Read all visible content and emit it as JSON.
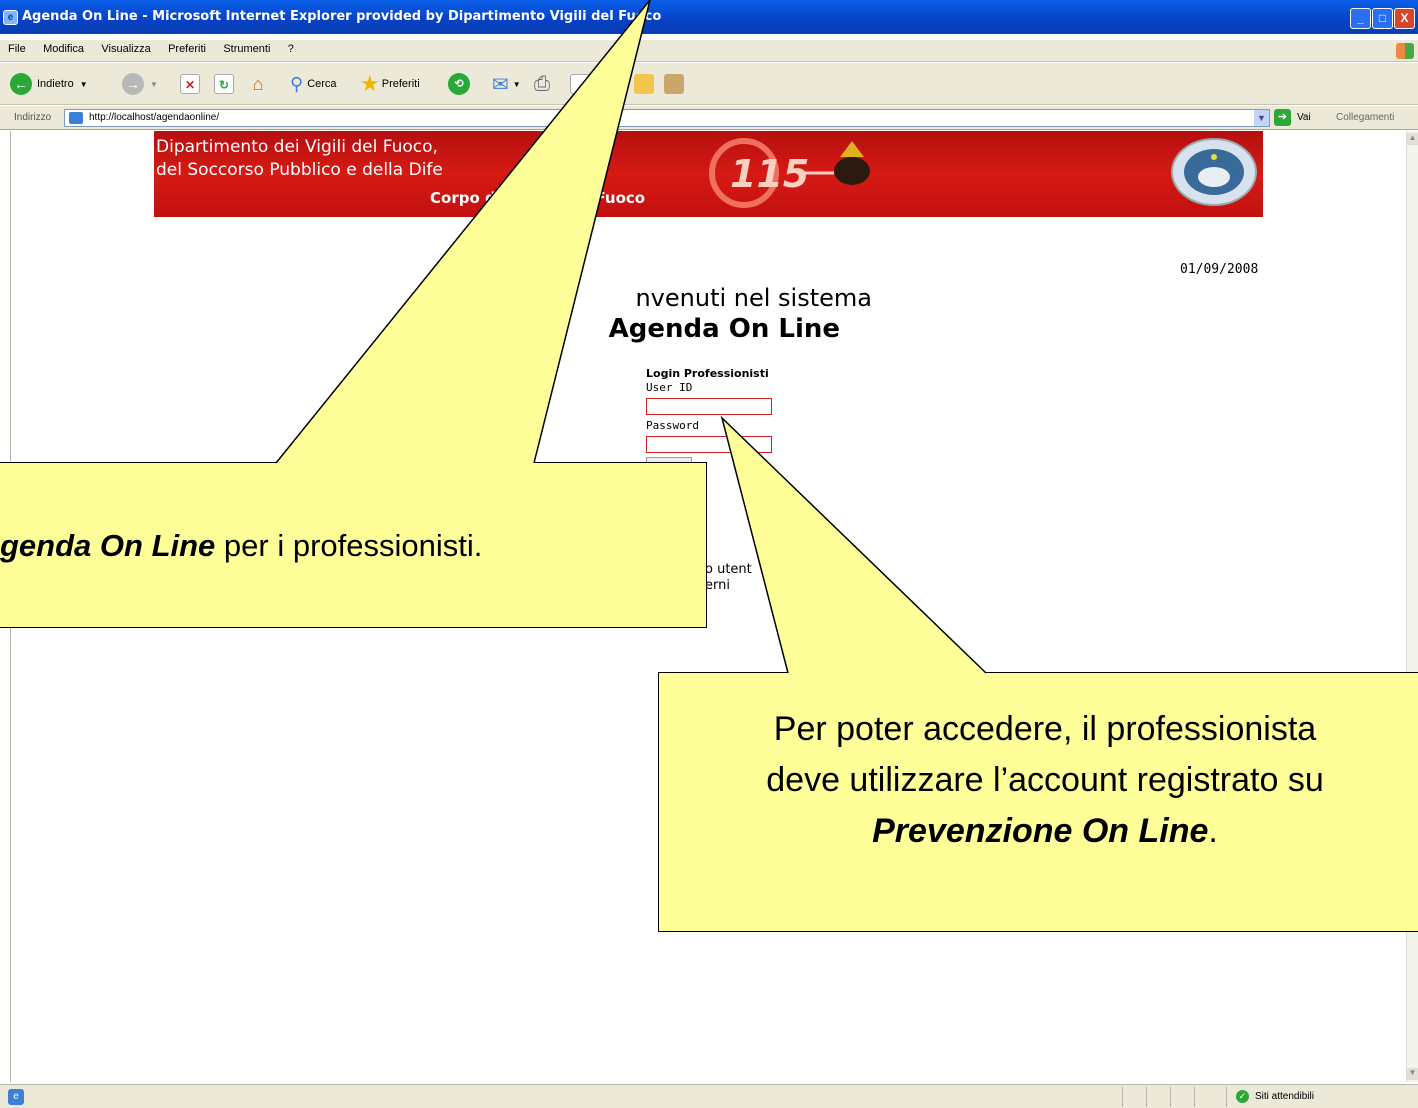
{
  "window": {
    "title": "Agenda On Line - Microsoft Internet Explorer provided by Dipartimento Vigili del Fuoco",
    "minimize": "_",
    "maximize": "□",
    "close": "X"
  },
  "menu": [
    "File",
    "Modifica",
    "Visualizza",
    "Preferiti",
    "Strumenti",
    "?"
  ],
  "toolbar": {
    "back": "Indietro",
    "search": "Cerca",
    "favorites": "Preferiti"
  },
  "addressbar": {
    "label": "Indirizzo",
    "url": "http://localhost/agendaonline/",
    "go": "Vai",
    "links": "Collegamenti"
  },
  "banner": {
    "line1": "Dipartimento dei Vigili del Fuoco,",
    "line2": "del Soccorso Pubblico e della Dife",
    "line3": "Corpo          dei Vigili del Fuoco",
    "emblem_number": "115"
  },
  "page": {
    "date": "01/09/2008",
    "welcome": "nvenuti nel sistema",
    "system_name": "Agenda On Line",
    "login_title": "Login Professionisti",
    "userid_label": "User ID",
    "password_label": "Password",
    "fragment1": "o utent",
    "fragment2": "erni"
  },
  "callout1": {
    "em": "genda On Line",
    "text": " per i professionisti."
  },
  "callout2": {
    "line1": "Per poter accedere, il professionista",
    "line2": "deve utilizzare l’account registrato su",
    "em": "Prevenzione On Line",
    "end": "."
  },
  "statusbar": {
    "zone": "Siti attendibili"
  },
  "colors": {
    "banner_red": "#d61a14",
    "callout_yellow": "#ffff99",
    "xp_blue": "#0741c6"
  }
}
